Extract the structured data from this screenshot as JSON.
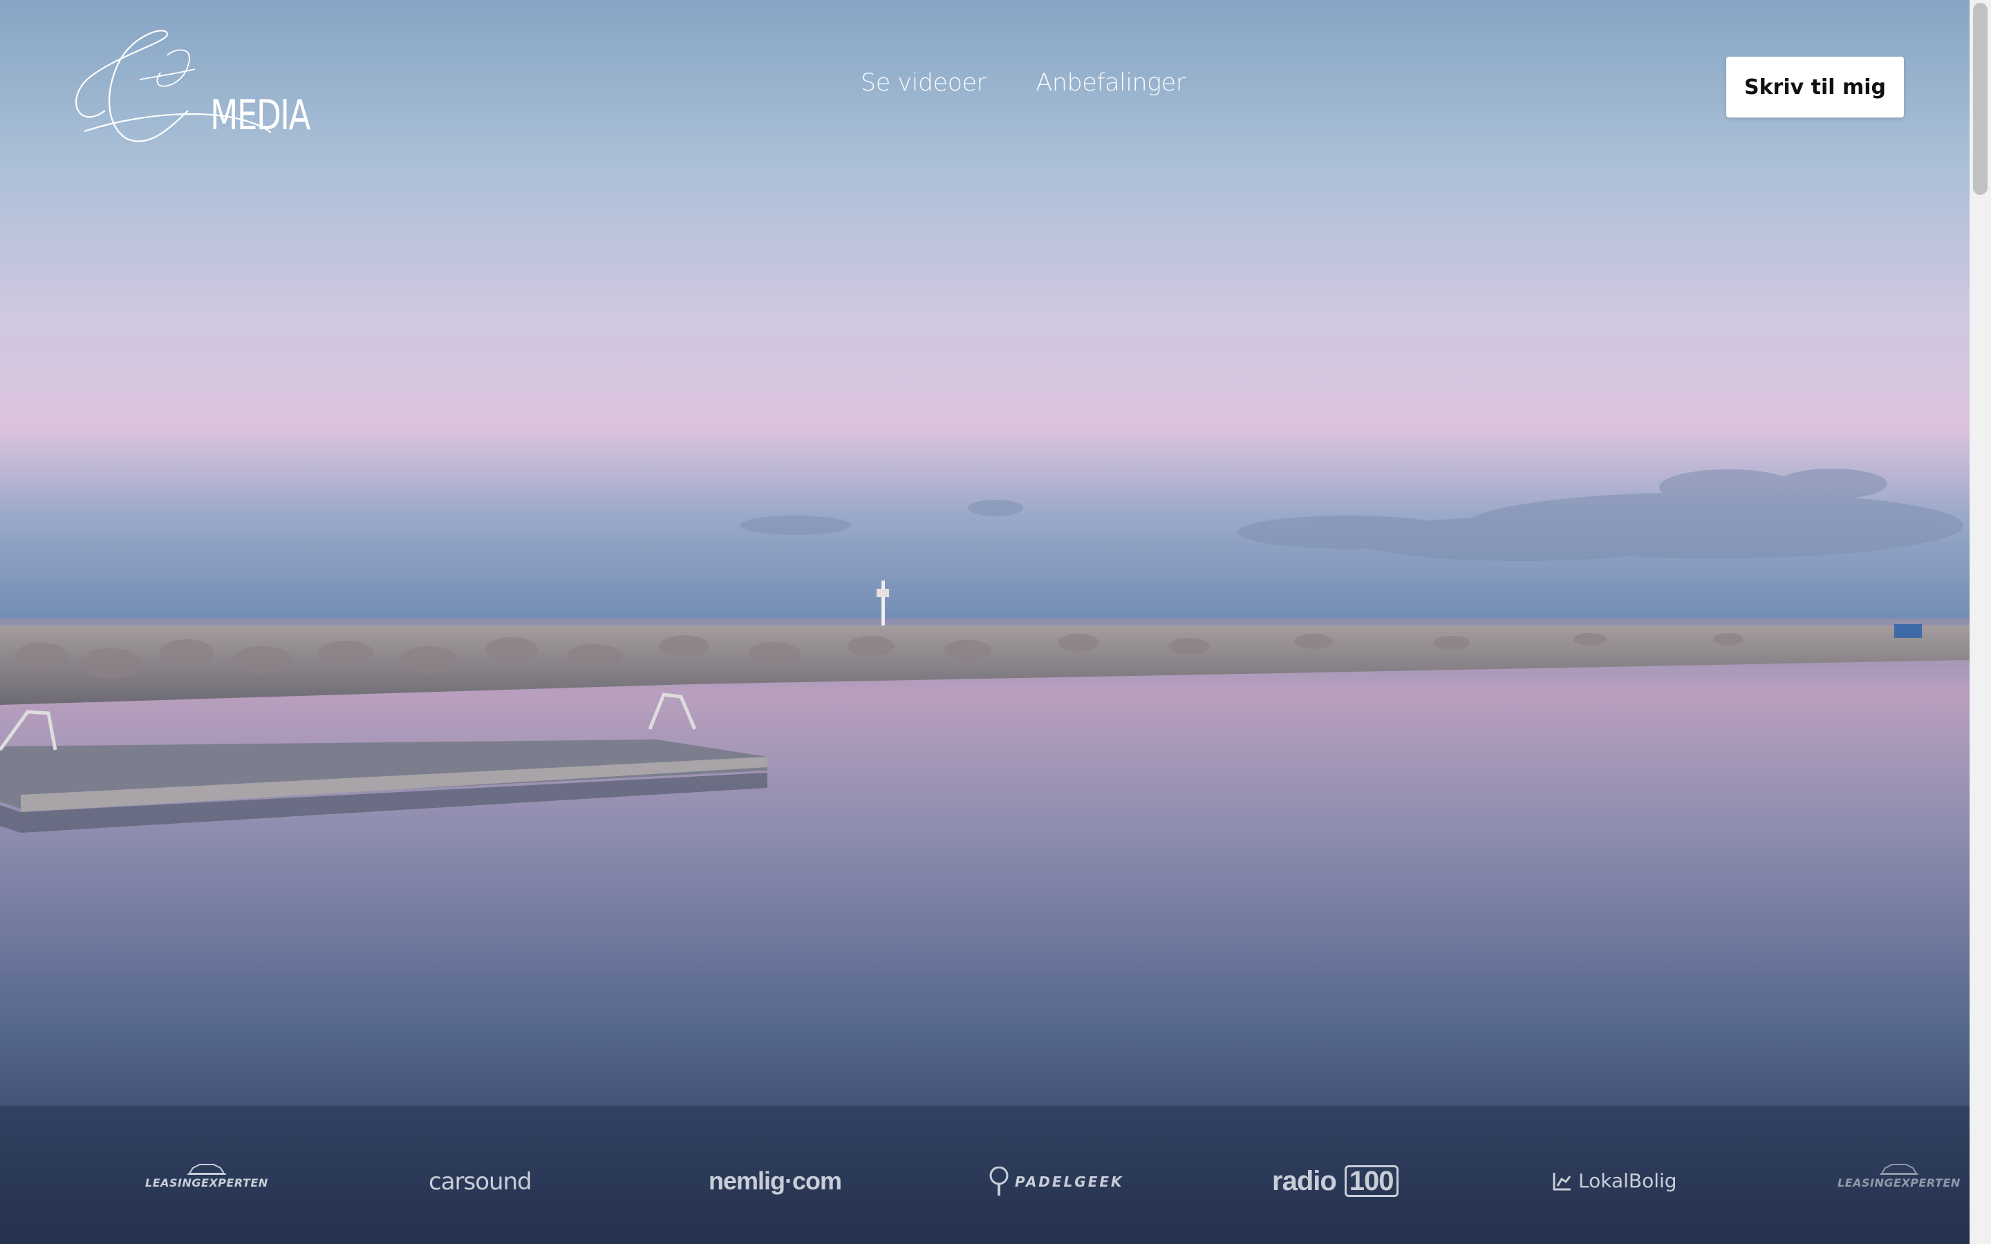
{
  "brand": {
    "signature": "Jesper Sandtré",
    "wordmark": "MEDIA"
  },
  "nav": {
    "items": [
      {
        "label": "Se videoer"
      },
      {
        "label": "Anbefalinger"
      }
    ]
  },
  "cta": {
    "label": "Skriv til mig"
  },
  "client_logos": [
    {
      "name": "LEASINGEXPERTEN",
      "icon": "car-icon"
    },
    {
      "name": "carsound"
    },
    {
      "name": "nemlig·com"
    },
    {
      "name": "PADELGEEK",
      "icon": "padel-racket-icon"
    },
    {
      "name": "radio",
      "badge": "100"
    },
    {
      "name": "LokalBolig",
      "icon": "chart-house-icon"
    },
    {
      "name": "LEASINGEXPERTEN",
      "icon": "car-icon"
    }
  ],
  "colors": {
    "sky_top": "#8aa8c7",
    "sky_pink": "#d9c6de",
    "water_bottom": "#2c3a57",
    "cta_bg": "#ffffff",
    "cta_text": "#111111",
    "nav_text": "#ffffff"
  }
}
